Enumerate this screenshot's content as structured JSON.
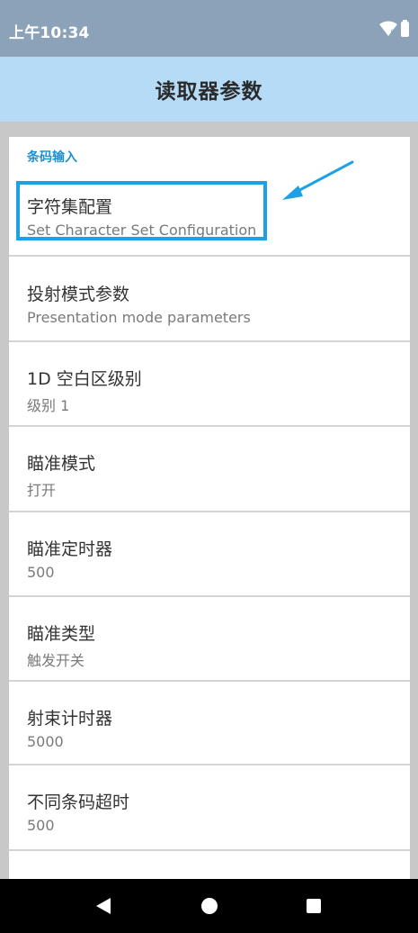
{
  "status_bar": {
    "time": "上午10:34",
    "icons": [
      "wifi-icon",
      "battery-icon"
    ]
  },
  "app_bar": {
    "title": "读取器参数"
  },
  "category": {
    "label": "条码输入"
  },
  "preferences": [
    {
      "title": "字符集配置",
      "summary": "Set Character Set Configuration",
      "highlighted": true
    },
    {
      "title": "投射模式参数",
      "summary": "Presentation mode parameters"
    },
    {
      "title": "1D 空白区级别",
      "summary": "级别 1"
    },
    {
      "title": "瞄准模式",
      "summary": "打开"
    },
    {
      "title": "瞄准定时器",
      "summary": "500"
    },
    {
      "title": "瞄准类型",
      "summary": "触发开关"
    },
    {
      "title": "射束计时器",
      "summary": "5000"
    },
    {
      "title": "不同条码超时",
      "summary": "500"
    }
  ],
  "navigation": {
    "buttons": [
      "back-icon",
      "home-icon",
      "recents-icon"
    ]
  },
  "colors": {
    "status_bar": "#8ba2b8",
    "app_bar": "#b5dbf7",
    "accent": "#1f90cf",
    "highlight": "#1ea0e6",
    "background": "#c8c8c8"
  }
}
